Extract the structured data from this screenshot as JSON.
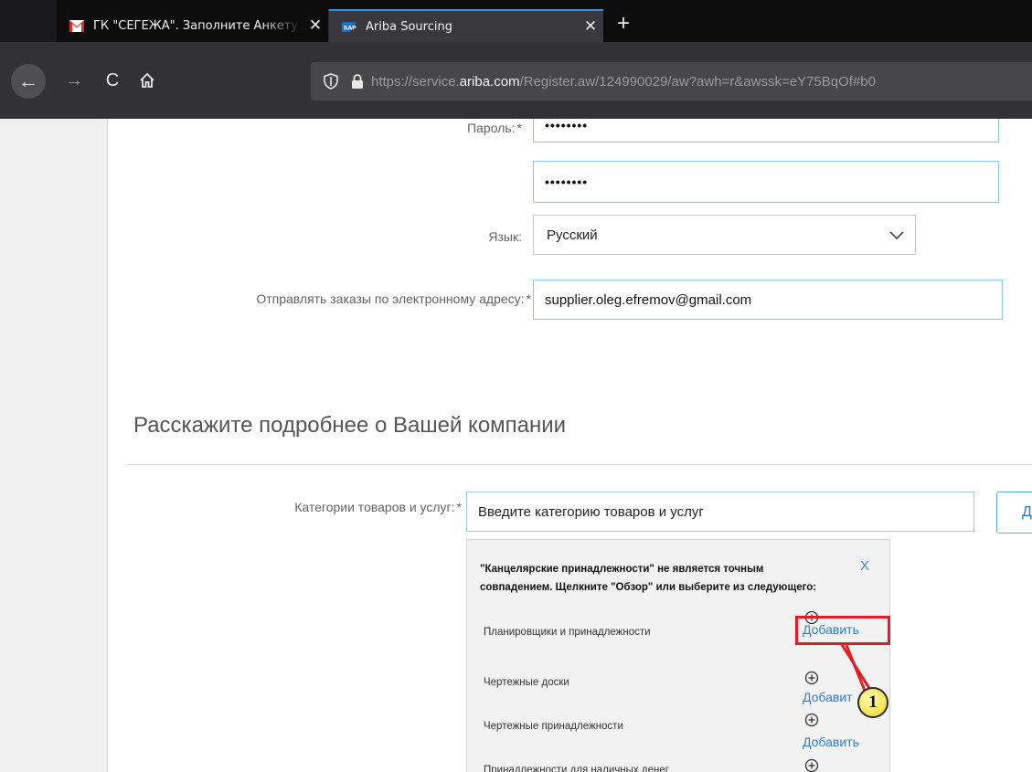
{
  "browser": {
    "tabs": [
      {
        "title": "ГК \"СЕГЕЖА\". Заполните Анкету",
        "close": "✕",
        "active": false
      },
      {
        "title": "Ariba Sourcing",
        "close": "✕",
        "active": true
      }
    ],
    "new_tab": "+",
    "nav": {
      "back": "←",
      "forward": "→",
      "reload": "C"
    },
    "url": {
      "scheme": "https://service.",
      "host": "ariba.com",
      "path": "/Register.aw/124990029/aw?awh=r&awssk=eY75BqOf#b0"
    }
  },
  "form": {
    "password_label": "Пароль:",
    "password_required": "*",
    "password_value": "••••••••",
    "confirm_password_value": "••••••••",
    "language_label": "Язык:",
    "language_value": "Русский",
    "order_email_label": "Отправлять заказы по электронному адресу:",
    "order_email_required": "*",
    "order_email_value": "supplier.oleg.efremov@gmail.com"
  },
  "company_section": {
    "title": "Расскажите подробнее о Вашей компании",
    "categories_label": "Категории товаров и услуг:",
    "categories_required": "*",
    "categories_placeholder": "Введите категорию товаров и услуг",
    "add_button_partial": "Д"
  },
  "suggestions": {
    "message": "\"Канцелярские принадлежности\" не является точным совпадением. Щелкните \"Обзор\" или выберите из следующего:",
    "close": "X",
    "add_label": "Добавить",
    "items": [
      {
        "name": "Планировщики и принадлежности",
        "add": "Добавить"
      },
      {
        "name": "Чертежные доски",
        "add": "Добавит"
      },
      {
        "name": "Чертежные принадлежности",
        "add": "Добавить"
      },
      {
        "name": "Принадлежности для наличных денег",
        "add": ""
      }
    ]
  },
  "annotation": {
    "callout_number": "1",
    "highlight_color": "#e01e26"
  },
  "colors": {
    "accent": "#2f7fc8",
    "field_border": "#89c4ef",
    "tab_active_top": "#3b8bdc"
  }
}
